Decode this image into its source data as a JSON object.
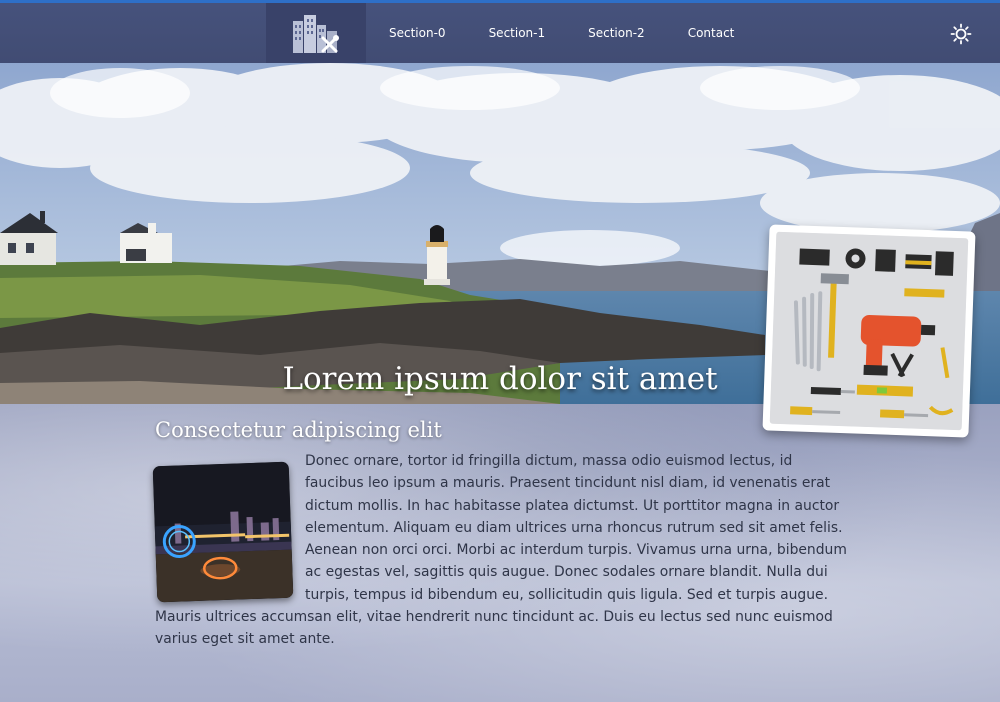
{
  "nav": {
    "items": [
      "Section-0",
      "Section-1",
      "Section-2",
      "Contact"
    ]
  },
  "icons": {
    "logo": "city-tools-logo-icon",
    "theme": "sun-icon"
  },
  "hero": {
    "title": "Lorem ipsum dolor sit amet"
  },
  "section": {
    "title": "Consectetur adipiscing elit",
    "body": "Donec ornare, tortor id fringilla dictum, massa odio euismod lectus, id faucibus leo ipsum a mauris. Praesent tincidunt nisl diam, id venenatis erat dictum mollis. In hac habitasse platea dictumst. Ut porttitor magna in auctor elementum. Aliquam eu diam ultrices urna rhoncus rutrum sed sit amet felis. Aenean non orci orci. Morbi ac interdum turpis. Vivamus urna urna, bibendum ac egestas vel, sagittis quis augue. Donec sodales ornare blandit. Nulla dui turpis, tempus id bibendum eu, sollicitudin quis ligula. Sed et turpis augue. Mauris ultrices accumsan elit, vitae hendrerit nunc tincidunt ac. Duis eu lectus sed nunc euismod varius eget sit amet ante."
  },
  "colors": {
    "nav_bg": "#434e76",
    "accent": "#2e6fc7",
    "text": "#2f3548"
  }
}
